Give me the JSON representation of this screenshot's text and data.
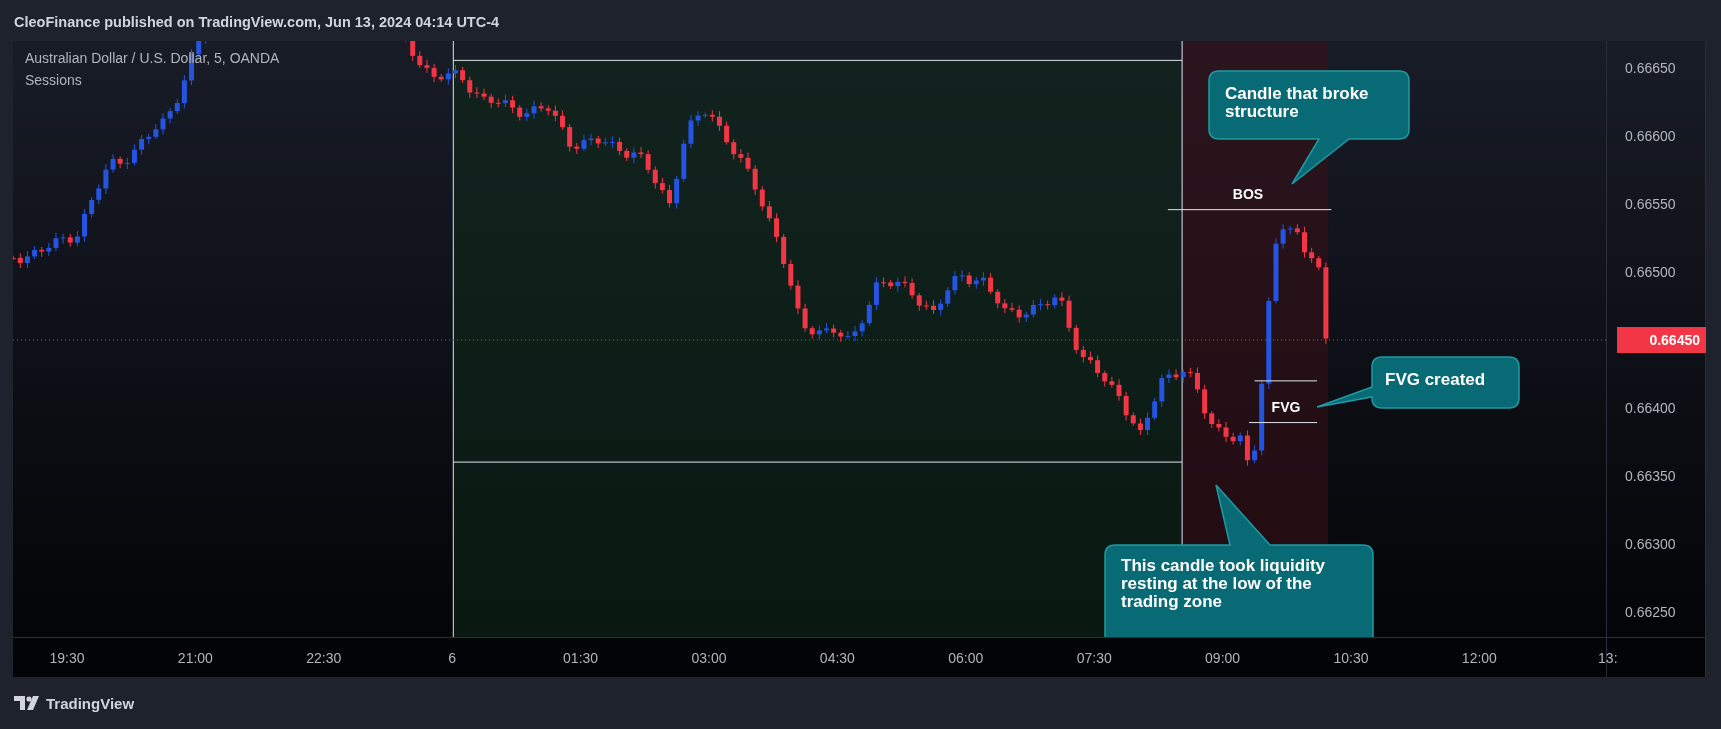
{
  "header": {
    "text": "CleoFinance published on TradingView.com, Jun 13, 2024 04:14 UTC-4"
  },
  "chart": {
    "symbol": "Australian Dollar / U.S. Dollar, 5, OANDA",
    "indicator": "Sessions",
    "price_axis": [
      "0.66650",
      "0.66600",
      "0.66550",
      "0.66500",
      "0.66400",
      "0.66350",
      "0.66300",
      "0.66250"
    ],
    "last_price": "0.66450",
    "time_axis": [
      "19:30",
      "21:00",
      "22:30",
      "6",
      "01:30",
      "03:00",
      "04:30",
      "06:00",
      "07:30",
      "09:00",
      "10:30",
      "12:00",
      "13:"
    ],
    "annotations": [
      {
        "kind": "callout",
        "text": "Candle that broke structure"
      },
      {
        "kind": "label",
        "text": "BOS"
      },
      {
        "kind": "label",
        "text": "FVG"
      },
      {
        "kind": "callout",
        "text": "FVG created"
      },
      {
        "kind": "callout",
        "text": "This candle took liquidity resting at the low of the trading zone"
      }
    ]
  },
  "footer": {
    "brand": "TradingView"
  }
}
